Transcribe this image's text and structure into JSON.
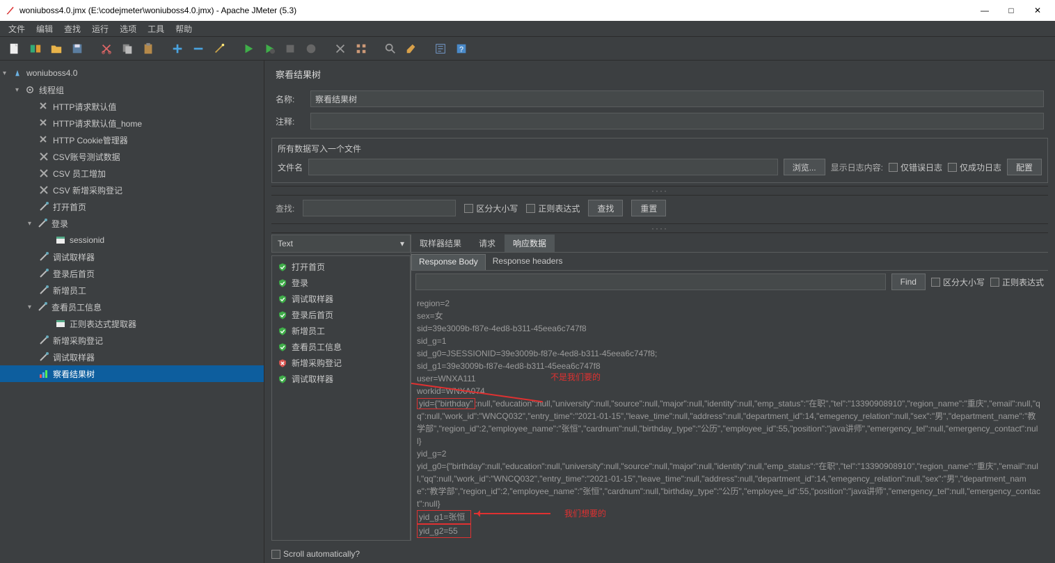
{
  "window": {
    "title": "woniuboss4.0.jmx (E:\\codejmeter\\woniuboss4.0.jmx) - Apache JMeter (5.3)"
  },
  "menu": [
    "文件",
    "编辑",
    "查找",
    "运行",
    "选项",
    "工具",
    "帮助"
  ],
  "tree": {
    "root": "woniuboss4.0",
    "thread_group": "线程组",
    "items": [
      "HTTP请求默认值",
      "HTTP请求默认值_home",
      "HTTP Cookie管理器",
      "CSV账号测试数据",
      "CSV 员工增加",
      "CSV 新增采购登记",
      "打开首页"
    ],
    "login": "登录",
    "login_children": [
      "sessionid"
    ],
    "after_login": [
      "调试取样器",
      "登录后首页",
      "新增员工"
    ],
    "view_emp": "查看员工信息",
    "view_emp_children": [
      "正则表达式提取器"
    ],
    "tail": [
      "新增采购登记",
      "调试取样器",
      "察看结果树"
    ]
  },
  "panel": {
    "title": "察看结果树",
    "name_label": "名称:",
    "name_value": "察看结果树",
    "comment_label": "注释:",
    "file_group_title": "所有数据写入一个文件",
    "file_label": "文件名",
    "browse": "浏览...",
    "log_display_label": "显示日志内容:",
    "only_error": "仅错误日志",
    "only_success": "仅成功日志",
    "configure": "配置",
    "search_label": "查找:",
    "case_sensitive": "区分大小写",
    "regex": "正则表达式",
    "search_btn": "查找",
    "reset_btn": "重置"
  },
  "results": {
    "type_select": "Text",
    "list": [
      {
        "label": "打开首页",
        "ok": true
      },
      {
        "label": "登录",
        "ok": true
      },
      {
        "label": "调试取样器",
        "ok": true
      },
      {
        "label": "登录后首页",
        "ok": true
      },
      {
        "label": "新增员工",
        "ok": true
      },
      {
        "label": "查看员工信息",
        "ok": true
      },
      {
        "label": "新增采购登记",
        "ok": false
      },
      {
        "label": "调试取样器",
        "ok": true
      }
    ],
    "tabs1": [
      "取样器结果",
      "请求",
      "响应数据"
    ],
    "tabs1_active": 2,
    "tabs2": [
      "Response Body",
      "Response headers"
    ],
    "tabs2_active": 0,
    "find_btn": "Find",
    "find_case": "区分大小写",
    "find_regex": "正则表达式",
    "body_lines": [
      "region=2",
      "sex=女",
      "sid=39e3009b-f87e-4ed8-b311-45eea6c747f8",
      "sid_g=1",
      "sid_g0=JSESSIONID=39e3009b-f87e-4ed8-b311-45eea6c747f8;",
      "sid_g1=39e3009b-f87e-4ed8-b311-45eea6c747f8",
      "user=WNXA111",
      "workid=WNXA074"
    ],
    "yid_pre": "yid=",
    "yid_hl": "{\"birthday\"",
    "yid_rest": ":null,\"education\":null,\"university\":null,\"source\":null,\"major\":null,\"identity\":null,\"emp_status\":\"在职\",\"tel\":\"13390908910\",\"region_name\":\"重庆\",\"email\":null,\"qq\":null,\"work_id\":\"WNCQ032\",\"entry_time\":\"2021-01-15\",\"leave_time\":null,\"address\":null,\"department_id\":14,\"emegency_relation\":null,\"sex\":\"男\",\"department_name\":\"教学部\",\"region_id\":2,\"employee_name\":\"张恒\",\"cardnum\":null,\"birthday_type\":\"公历\",\"employee_id\":55,\"position\":\"java讲师\",\"emergency_tel\":null,\"emergency_contact\":null}",
    "yid_g": "yid_g=2",
    "yid_g0": "yid_g0={\"birthday\":null,\"education\":null,\"university\":null,\"source\":null,\"major\":null,\"identity\":null,\"emp_status\":\"在职\",\"tel\":\"13390908910\",\"region_name\":\"重庆\",\"email\":null,\"qq\":null,\"work_id\":\"WNCQ032\",\"entry_time\":\"2021-01-15\",\"leave_time\":null,\"address\":null,\"department_id\":14,\"emegency_relation\":null,\"sex\":\"男\",\"department_name\":\"教学部\",\"region_id\":2,\"employee_name\":\"张恒\",\"cardnum\":null,\"birthday_type\":\"公历\",\"employee_id\":55,\"position\":\"java讲师\",\"emergency_tel\":null,\"emergency_contact\":null}",
    "yid_g1": "yid_g1=张恒",
    "yid_g2": "yid_g2=55",
    "anno1": "不是我们要的",
    "anno2": "我们想要的",
    "scroll_auto": "Scroll automatically?"
  }
}
